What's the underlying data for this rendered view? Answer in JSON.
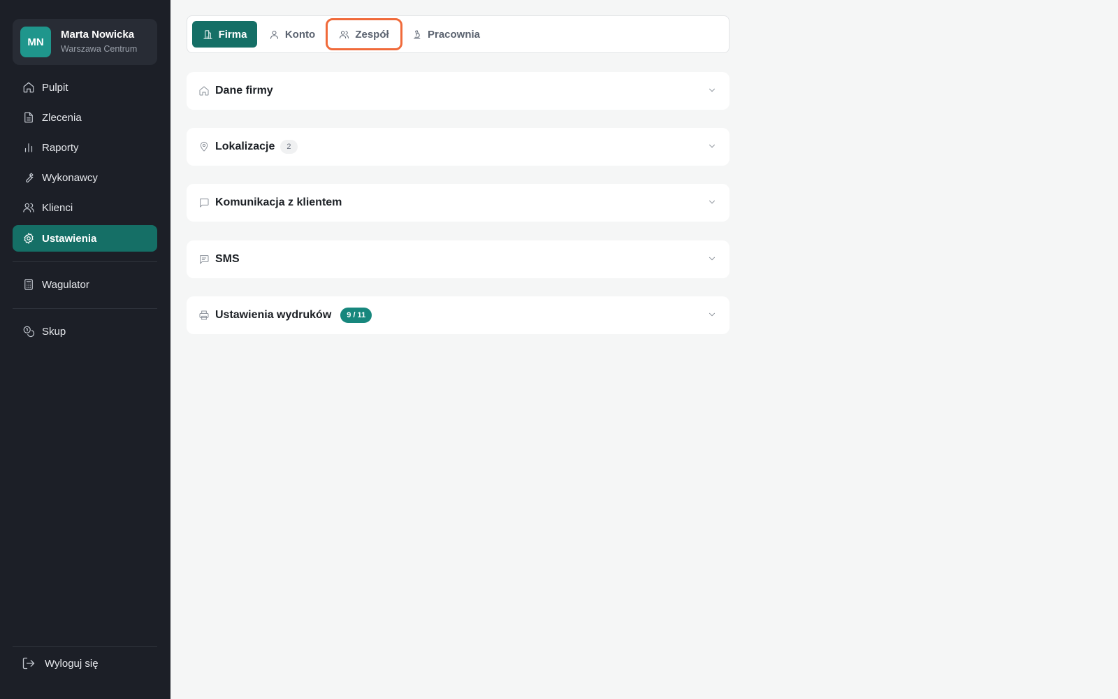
{
  "user": {
    "initials": "MN",
    "name": "Marta Nowicka",
    "location": "Warszawa Centrum"
  },
  "sidebar": {
    "items": [
      {
        "label": "Pulpit",
        "icon": "home-icon"
      },
      {
        "label": "Zlecenia",
        "icon": "document-icon"
      },
      {
        "label": "Raporty",
        "icon": "bar-chart-icon"
      },
      {
        "label": "Wykonawcy",
        "icon": "wrench-icon"
      },
      {
        "label": "Klienci",
        "icon": "users-icon"
      },
      {
        "label": "Ustawienia",
        "icon": "gear-icon",
        "active": true
      }
    ],
    "extra": [
      {
        "label": "Wagulator",
        "icon": "calculator-icon"
      },
      {
        "label": "Skup",
        "icon": "coins-icon"
      }
    ],
    "logout": "Wyloguj się"
  },
  "tabs": [
    {
      "label": "Firma",
      "icon": "building-icon",
      "active": true
    },
    {
      "label": "Konto",
      "icon": "user-icon"
    },
    {
      "label": "Zespół",
      "icon": "users-icon",
      "focused": true
    },
    {
      "label": "Pracownia",
      "icon": "microscope-icon"
    }
  ],
  "sections": [
    {
      "title": "Dane firmy",
      "icon": "home-icon"
    },
    {
      "title": "Lokalizacje",
      "icon": "map-pin-icon",
      "badge": "2"
    },
    {
      "title": "Komunikacja z klientem",
      "icon": "message-icon"
    },
    {
      "title": "SMS",
      "icon": "message-text-icon"
    },
    {
      "title": "Ustawienia wydruków",
      "icon": "printer-icon",
      "badge": "9 / 11"
    }
  ],
  "colors": {
    "sidebar_bg": "#1c1f27",
    "accent": "#156f66",
    "badge_teal": "#17877d",
    "focus_ring": "#f06a3a"
  }
}
